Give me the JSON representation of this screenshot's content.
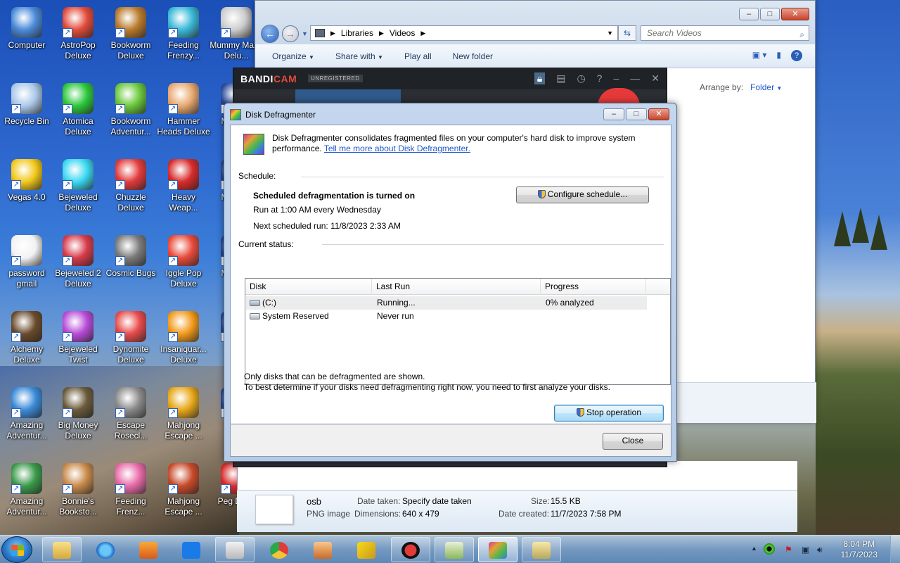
{
  "desktop": {
    "icons": [
      {
        "label": "Computer",
        "color": "#4a8ad8"
      },
      {
        "label": "AstroPop Deluxe",
        "color": "#e24a3a"
      },
      {
        "label": "Bookworm Deluxe",
        "color": "#b87a2a"
      },
      {
        "label": "Feeding Frenzy...",
        "color": "#3ab8d8"
      },
      {
        "label": "Mummy Maze Delu...",
        "color": "#cccccc"
      },
      {
        "label": "Recycle Bin",
        "color": "#aac8e8"
      },
      {
        "label": "Atomica Deluxe",
        "color": "#2ac83a"
      },
      {
        "label": "Bookworm Adventur...",
        "color": "#6ac83a"
      },
      {
        "label": "Hammer Heads Deluxe",
        "color": "#e8a870"
      },
      {
        "label": "My Th...",
        "color": "#2a4a9a"
      },
      {
        "label": "Vegas 4.0",
        "color": "#f2c81a"
      },
      {
        "label": "Bejeweled Deluxe",
        "color": "#3ad8f2"
      },
      {
        "label": "Chuzzle Deluxe",
        "color": "#e23a3a"
      },
      {
        "label": "Heavy Weap...",
        "color": "#d82a2a"
      },
      {
        "label": "My Th...",
        "color": "#2a4a9a"
      },
      {
        "label": "password gmail",
        "color": "#f2f2f2"
      },
      {
        "label": "Bejeweled 2 Deluxe",
        "color": "#d83a4a"
      },
      {
        "label": "Cosmic Bugs",
        "color": "#7a7a7a"
      },
      {
        "label": "Iggle Pop Deluxe",
        "color": "#e84a3a"
      },
      {
        "label": "My Th...",
        "color": "#2a4a9a"
      },
      {
        "label": "Alchemy Deluxe",
        "color": "#6a4a2a"
      },
      {
        "label": "Bejeweled Twist",
        "color": "#b84ad8"
      },
      {
        "label": "Dynomite Deluxe",
        "color": "#e84a4a"
      },
      {
        "label": "Insaniquar... Deluxe",
        "color": "#f29a1a"
      },
      {
        "label": "I...",
        "color": "#2a4a9a"
      },
      {
        "label": "Amazing Adventur...",
        "color": "#3a8ad8"
      },
      {
        "label": "Big Money Deluxe",
        "color": "#6a5a3a"
      },
      {
        "label": "Escape Rosecl...",
        "color": "#8a8a8a"
      },
      {
        "label": "Mahjong Escape ...",
        "color": "#e8a81a"
      },
      {
        "label": "N...",
        "color": "#2a4a9a"
      },
      {
        "label": "Amazing Adventur...",
        "color": "#3a9a4a"
      },
      {
        "label": "Bonnie's Booksto...",
        "color": "#c88a4a"
      },
      {
        "label": "Feeding Frenz...",
        "color": "#e86aa8"
      },
      {
        "label": "Mahjong Escape ...",
        "color": "#c84a2a"
      },
      {
        "label": "Peg Del...",
        "color": "#d82a2a"
      }
    ]
  },
  "explorer": {
    "breadcrumb": [
      "Libraries",
      "Videos"
    ],
    "search_placeholder": "Search Videos",
    "toolbar": {
      "organize": "Organize",
      "share_with": "Share with",
      "play_all": "Play all",
      "new_folder": "New folder"
    },
    "arrange_label": "Arrange by:",
    "arrange_value": "Folder",
    "details": {
      "name": "osb",
      "type": "PNG image",
      "date_taken_label": "Date taken:",
      "date_taken_value": "Specify date taken",
      "dimensions_label": "Dimensions:",
      "dimensions_value": "640 x 479",
      "size_label": "Size:",
      "size_value": "15.5 KB",
      "date_created_label": "Date created:",
      "date_created_value": "11/7/2023 7:58 PM"
    }
  },
  "bandicam": {
    "logo_a": "BANDI",
    "logo_b": "CAM",
    "badge": "UNREGISTERED"
  },
  "defrag": {
    "title": "Disk Defragmenter",
    "intro": "Disk Defragmenter consolidates fragmented files on your computer's hard disk to improve system performance.",
    "intro_link": "Tell me more about Disk Defragmenter.",
    "schedule_label": "Schedule:",
    "schedule_status": "Scheduled defragmentation is turned on",
    "schedule_run": "Run at 1:00 AM every Wednesday",
    "schedule_next": "Next scheduled run: 11/8/2023 2:33 AM",
    "configure_button": "Configure schedule...",
    "status_label": "Current status:",
    "columns": [
      "Disk",
      "Last Run",
      "Progress"
    ],
    "rows": [
      {
        "disk": "(C:)",
        "last_run": "Running...",
        "progress": "0% analyzed"
      },
      {
        "disk": "System Reserved",
        "last_run": "Never run",
        "progress": ""
      }
    ],
    "note1": "Only disks that can be defragmented are shown.",
    "note2": "To best determine if your disks need defragmenting right now, you need to first analyze your disks.",
    "stop_button": "Stop operation",
    "close_button": "Close"
  },
  "taskbar": {
    "time": "8:04 PM",
    "date": "11/7/2023"
  }
}
